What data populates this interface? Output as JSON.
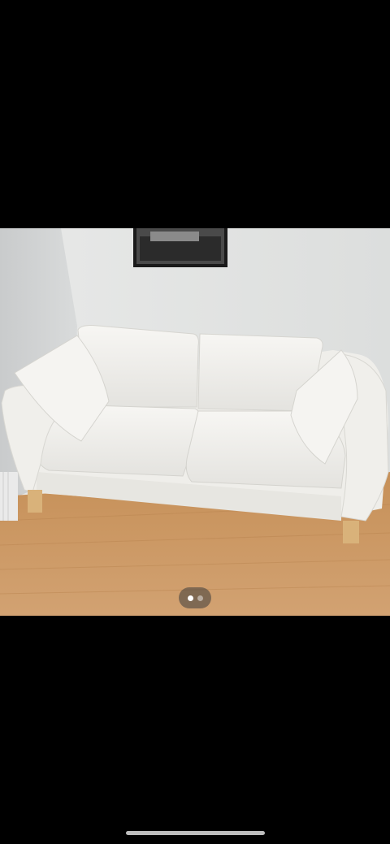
{
  "gallery": {
    "photo_subject": "sofa-photo",
    "total_images": 2,
    "active_index": 1
  },
  "colors": {
    "background": "#000000",
    "wall": "#e6e7e6",
    "floor": "#c89a6a",
    "sofa": "#f3f2ee"
  }
}
